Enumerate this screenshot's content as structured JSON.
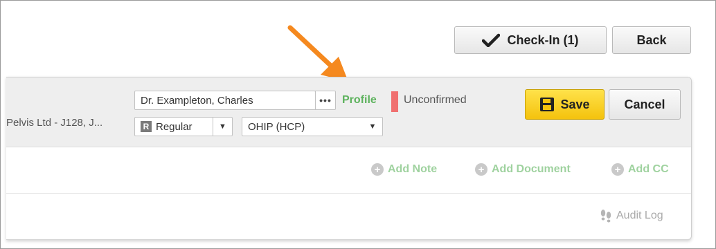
{
  "toolbar": {
    "checkin_label": "Check-In (1)",
    "back_label": "Back"
  },
  "appointment": {
    "clinic_text": "Pelvis Ltd - J128, J...",
    "doctor_value": "Dr. Exampleton, Charles",
    "more_label": "•••",
    "profile_label": "Profile",
    "status_text": "Unconfirmed",
    "status_color": "#f07070",
    "type_badge": "R",
    "type_value": "Regular",
    "payer_value": "OHIP (HCP)",
    "save_label": "Save",
    "cancel_label": "Cancel"
  },
  "actions": {
    "add_note": "Add Note",
    "add_document": "Add Document",
    "add_cc": "Add CC",
    "audit_log": "Audit Log"
  },
  "colors": {
    "accent_green": "#5cb25c",
    "save_yellow": "#f4c20d",
    "annotation_arrow": "#f5891f"
  }
}
